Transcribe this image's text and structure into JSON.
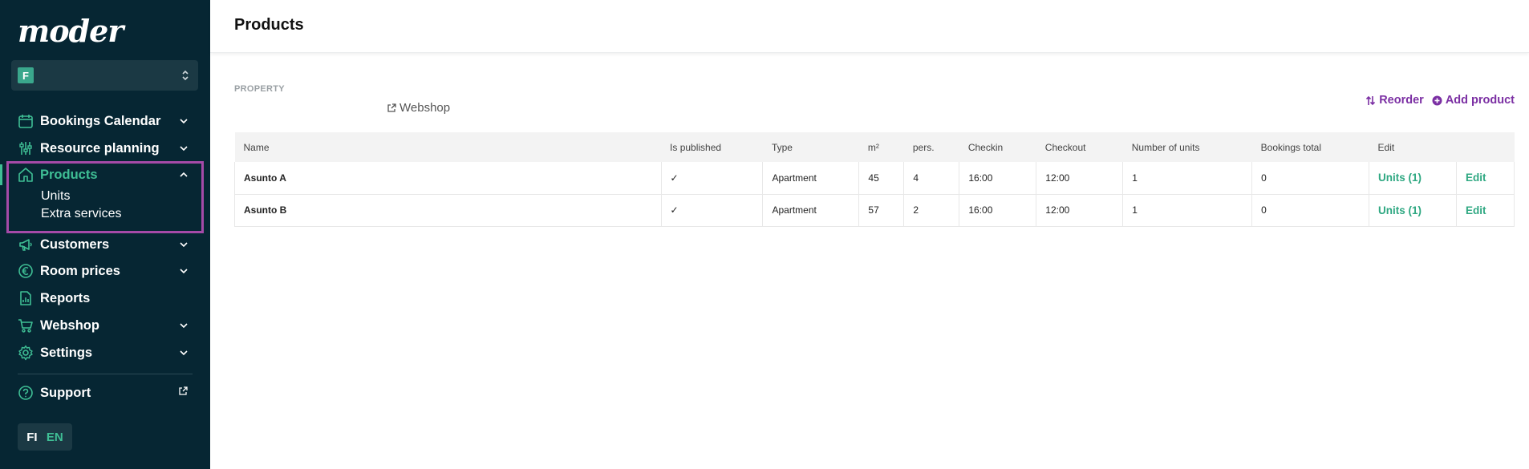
{
  "app": {
    "logo_text": "moder",
    "org_initial": "F"
  },
  "colors": {
    "sidebar_bg": "#062633",
    "accent_green": "#3fbf95",
    "accent_purple": "#7b2fa3",
    "highlight_box": "#a54aa8"
  },
  "sidebar": {
    "items": [
      {
        "label": "Bookings Calendar",
        "icon": "calendar-icon",
        "has_chevron": true
      },
      {
        "label": "Resource planning",
        "icon": "sliders-icon",
        "has_chevron": true
      },
      {
        "label": "Products",
        "icon": "home-icon",
        "has_chevron": true,
        "active": true
      },
      {
        "label": "Customers",
        "icon": "megaphone-icon",
        "has_chevron": true
      },
      {
        "label": "Room prices",
        "icon": "euro-icon",
        "has_chevron": true
      },
      {
        "label": "Reports",
        "icon": "report-icon",
        "has_chevron": false
      },
      {
        "label": "Webshop",
        "icon": "cart-icon",
        "has_chevron": true
      },
      {
        "label": "Settings",
        "icon": "gear-icon",
        "has_chevron": true
      }
    ],
    "sub_items": [
      "Units",
      "Extra services"
    ],
    "support_label": "Support",
    "lang": {
      "fi": "FI",
      "en": "EN"
    }
  },
  "header": {
    "title": "Products"
  },
  "main": {
    "section_label": "PROPERTY",
    "webshop_link": "Webshop",
    "reorder_label": "Reorder",
    "add_product_label": "Add product"
  },
  "table": {
    "columns": [
      "Name",
      "Is published",
      "Type",
      "m²",
      "pers.",
      "Checkin",
      "Checkout",
      "Number of units",
      "Bookings total",
      "Edit",
      ""
    ],
    "rows": [
      {
        "name": "Asunto A",
        "published": "✓",
        "type": "Apartment",
        "m2": "45",
        "pers": "4",
        "checkin": "16:00",
        "checkout": "12:00",
        "units": "1",
        "bookings": "0",
        "units_link": "Units (1)",
        "edit": "Edit"
      },
      {
        "name": "Asunto B",
        "published": "✓",
        "type": "Apartment",
        "m2": "57",
        "pers": "2",
        "checkin": "16:00",
        "checkout": "12:00",
        "units": "1",
        "bookings": "0",
        "units_link": "Units (1)",
        "edit": "Edit"
      }
    ]
  }
}
